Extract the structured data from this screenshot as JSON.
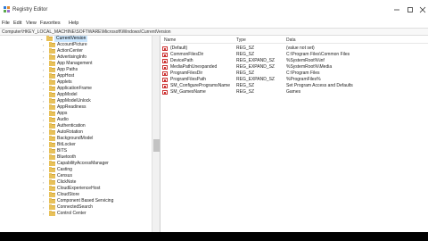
{
  "window": {
    "title": "Registry Editor",
    "icon": "registry-icon",
    "controls": [
      "minimize-icon",
      "maximize-icon",
      "close-icon"
    ]
  },
  "menu": {
    "items": [
      "File",
      "Edit",
      "View",
      "Favorites",
      "Help"
    ]
  },
  "address": {
    "path": "Computer\\HKEY_LOCAL_MACHINE\\SOFTWARE\\Microsoft\\Windows\\CurrentVersion"
  },
  "tree": {
    "selected": "CurrentVersion",
    "items": [
      "CurrentVersion",
      "AccountPicture",
      "ActionCenter",
      "AdvertisingInfo",
      "App Management",
      "App Paths",
      "AppHost",
      "Applets",
      "ApplicationFrame",
      "AppModel",
      "AppModelUnlock",
      "AppReadiness",
      "Apps",
      "Audio",
      "Authentication",
      "AutoRotation",
      "BackgroundModel",
      "BitLocker",
      "BITS",
      "Bluetooth",
      "CapabilityAccessManager",
      "Casting",
      "Census",
      "ClickNote",
      "CloudExperienceHost",
      "CloudStore",
      "Component Based Servicing",
      "ConnectedSearch",
      "Control Center"
    ]
  },
  "values": {
    "columns": {
      "name": "Name",
      "type": "Type",
      "data": "Data"
    },
    "rows": [
      {
        "name": "(Default)",
        "type": "REG_SZ",
        "data": "(value not set)"
      },
      {
        "name": "CommonFilesDir",
        "type": "REG_SZ",
        "data": "C:\\Program Files\\Common Files"
      },
      {
        "name": "DevicePath",
        "type": "REG_EXPAND_SZ",
        "data": "%SystemRoot%\\inf"
      },
      {
        "name": "MediaPathUnexpanded",
        "type": "REG_EXPAND_SZ",
        "data": "%SystemRoot%\\Media"
      },
      {
        "name": "ProgramFilesDir",
        "type": "REG_SZ",
        "data": "C:\\Program Files"
      },
      {
        "name": "ProgramFilesPath",
        "type": "REG_EXPAND_SZ",
        "data": "%ProgramFiles%"
      },
      {
        "name": "SM_ConfigureProgramsName",
        "type": "REG_SZ",
        "data": "Set Program Access and Defaults"
      },
      {
        "name": "SM_GamesName",
        "type": "REG_SZ",
        "data": "Games"
      }
    ]
  }
}
